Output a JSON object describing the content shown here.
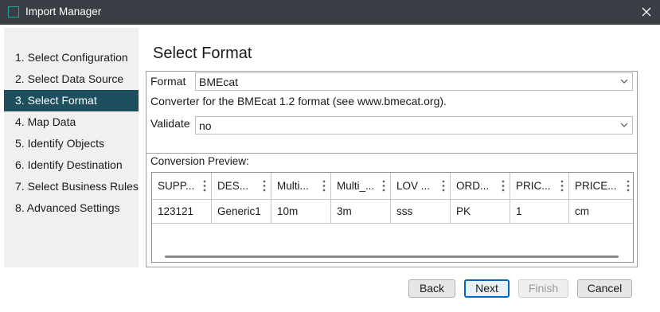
{
  "window": {
    "title": "Import Manager"
  },
  "sidebar": {
    "items": [
      {
        "label": "1. Select Configuration",
        "active": false
      },
      {
        "label": "2. Select Data Source",
        "active": false
      },
      {
        "label": "3. Select Format",
        "active": true
      },
      {
        "label": "4. Map Data",
        "active": false
      },
      {
        "label": "5. Identify Objects",
        "active": false
      },
      {
        "label": "6. Identify Destination",
        "active": false
      },
      {
        "label": "7. Select Business Rules",
        "active": false
      },
      {
        "label": "8. Advanced Settings",
        "active": false
      }
    ]
  },
  "main": {
    "heading": "Select Format",
    "format_label": "Format",
    "format_value": "BMEcat",
    "format_description": "Converter for the BMEcat 1.2 format (see www.bmecat.org).",
    "validate_label": "Validate",
    "validate_value": "no",
    "preview_label": "Conversion Preview:",
    "table": {
      "headers": [
        "SUPP...",
        "DES...",
        "Multi...",
        "Multi_...",
        "LOV ...",
        "ORD...",
        "PRIC...",
        "PRICE..."
      ],
      "rows": [
        [
          "123121",
          "Generic1",
          "10m",
          "3m",
          "sss",
          "PK",
          "1",
          "cm"
        ]
      ]
    }
  },
  "footer": {
    "back_label": "Back",
    "next_label": "Next",
    "finish_label": "Finish",
    "cancel_label": "Cancel"
  },
  "colors": {
    "titlebar": "#3a3e44",
    "active_step": "#1e4f5e",
    "app_icon_accent": "#1fa3a3",
    "primary_button_border": "#0067c0"
  },
  "icons": {
    "app": "app-icon",
    "close": "close-icon",
    "dropdown": "chevron-down-icon",
    "column_menu": "column-menu-icon"
  }
}
